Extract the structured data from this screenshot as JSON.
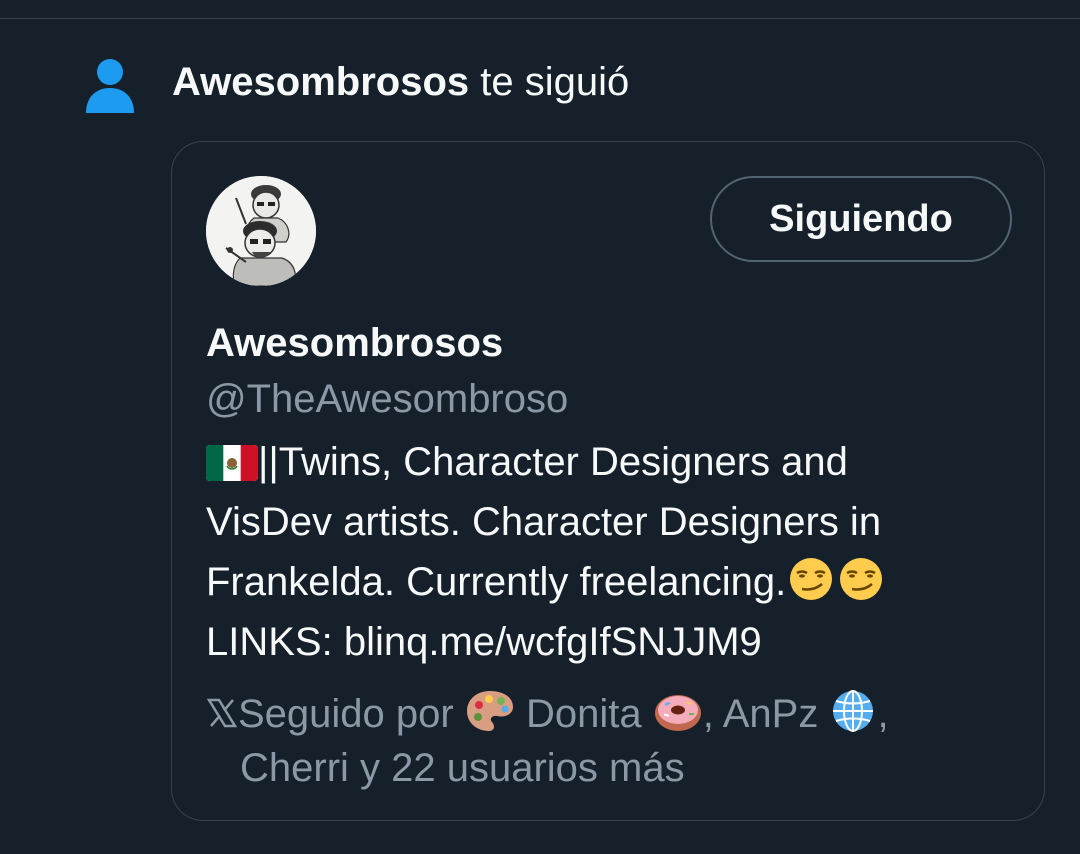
{
  "notification": {
    "icon": "person-icon",
    "user": "Awesombrosos",
    "action": " te siguió",
    "icon_color": "#1d9bf0"
  },
  "card": {
    "avatar": "avatar",
    "follow_button": "Siguiendo",
    "display_name": "Awesombrosos",
    "handle": "@TheAwesombroso",
    "bio": {
      "line1": "||Twins, Character Designers and",
      "line2": "VisDev artists. Character Designers in",
      "line3": "Frankelda. Currently freelancing.",
      "line4_prefix": "LINKS: ",
      "link": "blinq.me/wcfgIfSNJJM9",
      "flag_icon": "mexico-flag-icon",
      "emoji_icon": "smirking-face-icon"
    },
    "followed_by": {
      "prefix": "Seguido por ",
      "user1": " Donita ",
      "user1_icon_before": "palette-icon",
      "user1_icon_after": "doughnut-icon",
      "sep1": ", AnPz ",
      "user2_icon": "globe-icon",
      "sep2": ",",
      "line2": "Cherri y 22 usuarios más"
    }
  },
  "colors": {
    "background": "#15202b",
    "border": "#38444d",
    "text_primary": "#f7f9f9",
    "text_secondary": "#8b98a5",
    "accent": "#1d9bf0"
  }
}
